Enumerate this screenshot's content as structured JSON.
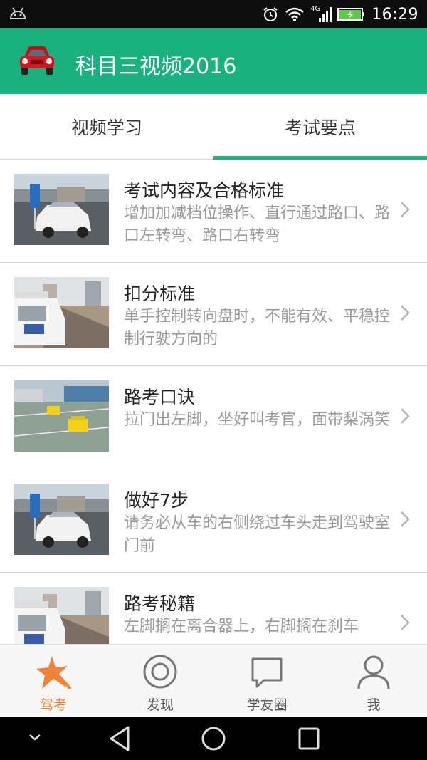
{
  "status_bar": {
    "time": "16:29",
    "network_label": "4G",
    "icons": [
      "android-icon",
      "alarm-icon",
      "wifi-icon",
      "signal-icon",
      "battery-charging-icon"
    ]
  },
  "app_bar": {
    "title": "科目三视频2016",
    "icon": "red-car-icon",
    "accent_color": "#1bb17f"
  },
  "tabs": [
    {
      "label": "视频学习",
      "active": false
    },
    {
      "label": "考试要点",
      "active": true
    }
  ],
  "list": [
    {
      "title": "考试内容及合格标准",
      "desc": "增加加减档位操作、直行通过路口、路口左转弯、路口右转弯",
      "thumb": "white-car-test-ground"
    },
    {
      "title": "扣分标准",
      "desc": "单手控制转向盘时，不能有效、平稳控制行驶方向的",
      "thumb": "coach-car-road"
    },
    {
      "title": "路考口诀",
      "desc": "拉门出左脚，坐好叫考官，面带梨涡笑",
      "thumb": "test-yard-yellow-cars"
    },
    {
      "title": "做好7步",
      "desc": "请务必从车的右侧绕过车头走到驾驶室门前",
      "thumb": "white-car-test-ground"
    },
    {
      "title": "路考秘籍",
      "desc": "左脚搁在离合器上，右脚搁在刹车",
      "thumb": "coach-car-road"
    }
  ],
  "bottom_nav": [
    {
      "label": "驾考",
      "icon": "star-icon",
      "active": true
    },
    {
      "label": "发现",
      "icon": "target-icon",
      "active": false
    },
    {
      "label": "学友圈",
      "icon": "chat-bubble-icon",
      "active": false
    },
    {
      "label": "我",
      "icon": "person-icon",
      "active": false
    }
  ],
  "colors": {
    "accent": "#1bb17f",
    "active_nav": "#f0833a",
    "desc_text": "#9a9a9a"
  }
}
